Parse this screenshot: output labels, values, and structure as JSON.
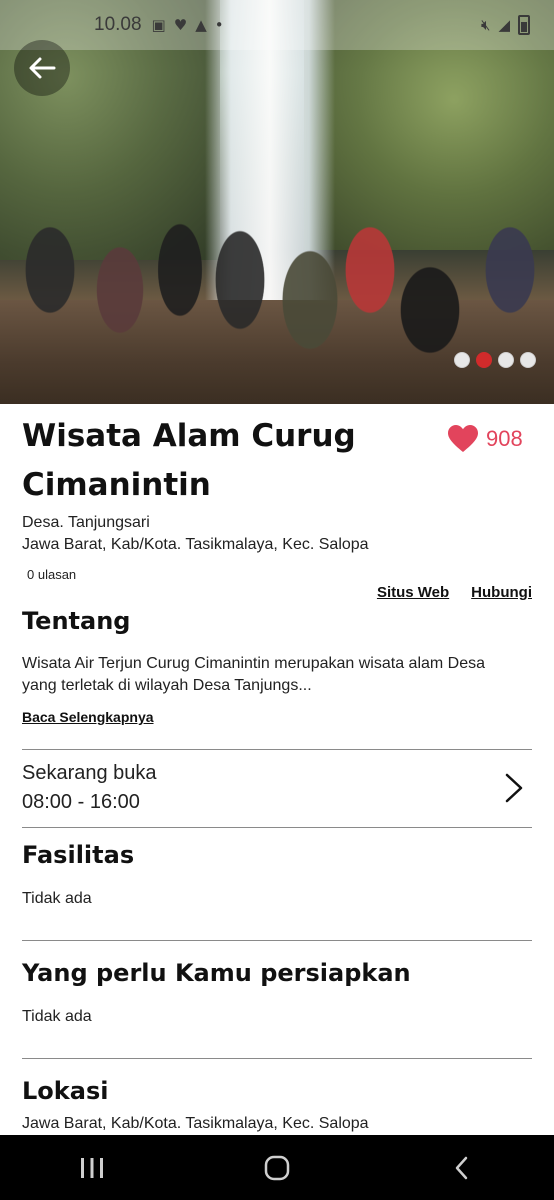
{
  "status_bar": {
    "time": "10.08",
    "icons": [
      "image-icon",
      "heart-icon",
      "warning-icon",
      "dot-icon"
    ],
    "right_icons": [
      "mute-icon",
      "signal-icon",
      "battery-icon"
    ]
  },
  "hero": {
    "slides_total": 4,
    "active_slide": 2
  },
  "place": {
    "title": "Wisata Alam Curug Cimanintin",
    "likes": "908",
    "address_line1": "Desa. Tanjungsari",
    "address_line2": "Jawa Barat, Kab/Kota. Tasikmalaya, Kec. Salopa",
    "reviews": "0 ulasan"
  },
  "links": {
    "website": "Situs Web",
    "contact": "Hubungi"
  },
  "about": {
    "heading": "Tentang",
    "text_line1": "Wisata Air Terjun Curug Cimanintin merupakan wisata alam Desa",
    "text_line2": "yang terletak di wilayah Desa Tanjungs...",
    "read_more": "Baca Selengkapnya"
  },
  "hours": {
    "status": "Sekarang buka",
    "range": "08:00 - 16:00"
  },
  "facilities": {
    "heading": "Fasilitas",
    "value": "Tidak ada"
  },
  "prepare": {
    "heading": "Yang perlu Kamu persiapkan",
    "value": "Tidak ada"
  },
  "location": {
    "heading": "Lokasi",
    "value": "Jawa Barat, Kab/Kota. Tasikmalaya, Kec. Salopa"
  },
  "colors": {
    "accent": "#e2445c",
    "active_dot": "#d12b2b",
    "navbar": "#000000"
  },
  "nav": {
    "recents": "recents-icon",
    "home": "home-icon",
    "back": "back-icon"
  }
}
